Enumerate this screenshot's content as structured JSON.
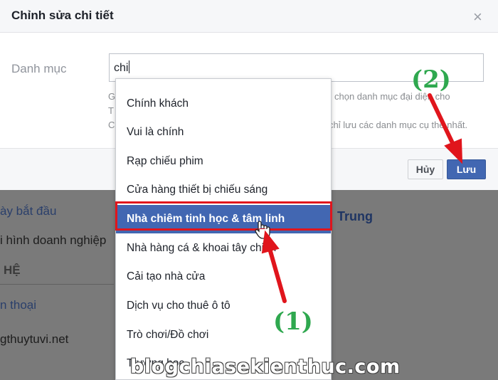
{
  "dialog": {
    "title": "Chỉnh sửa chi tiết",
    "close_glyph": "×",
    "field_label": "Danh mục",
    "input_value": "chi",
    "help_fragments": [
      "G",
      "T",
      "C",
      "chọn danh mục đại diện cho",
      "chỉ lưu các danh mục cụ thể nhất."
    ],
    "cancel_label": "Hủy",
    "save_label": "Lưu"
  },
  "background_page": {
    "left_items": [
      {
        "text": "ày bắt đầu",
        "kind": "link"
      },
      {
        "text": "i hình doanh nghiệp",
        "kind": "text"
      },
      {
        "text": "HỆ",
        "kind": "heading"
      },
      {
        "text": "n thoại",
        "kind": "link"
      },
      {
        "text": "gthuytuvi.net",
        "kind": "text"
      }
    ],
    "right_text": "Trung"
  },
  "dropdown": {
    "items": [
      "Chính khách",
      "Vui là chính",
      "Rạp chiếu phim",
      "Cửa hàng thiết bị chiếu sáng",
      "Nhà chiêm tinh học & tâm linh",
      "Nhà hàng cá & khoai tây chiên",
      "Cải tạo nhà cửa",
      "Dịch vụ cho thuê ô tô",
      "Trò chơi/Đồ chơi",
      "Trường học"
    ],
    "selected_index": 4
  },
  "annotations": {
    "step1": "(1)",
    "step2": "(2)",
    "watermark": "blogchiasekienthuc.com",
    "arrow_color": "#e0151c",
    "label_color": "#2fa84f"
  },
  "colors": {
    "accent": "#4267b2",
    "highlight": "#e0151c"
  }
}
